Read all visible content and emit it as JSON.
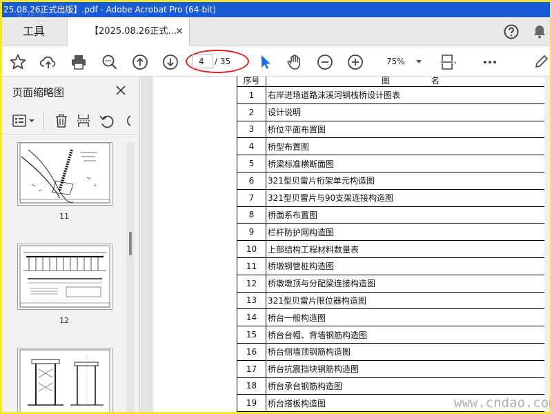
{
  "window": {
    "title": "25.08.26正式出版】.pdf - Adobe Acrobat Pro (64-bit)",
    "watermark_logo": "查标网"
  },
  "tabs": {
    "tools_label": "工具",
    "doc_label": "【2025.08.26正式...",
    "close_glyph": "✕"
  },
  "toolbar": {
    "page_current": "4",
    "page_total": "/ 35",
    "zoom": "75%"
  },
  "sidepanel": {
    "title": "页面缩略图",
    "thumbnails": [
      {
        "label": "11"
      },
      {
        "label": "12"
      },
      {
        "label": ""
      }
    ]
  },
  "document": {
    "header": {
      "no": "序号",
      "name": "图　　　　　名"
    },
    "rows": [
      {
        "no": "1",
        "name": "右岸进场道路沫溪河钢栈桥设计图表"
      },
      {
        "no": "2",
        "name": "设计说明"
      },
      {
        "no": "3",
        "name": "桥位平面布置图"
      },
      {
        "no": "4",
        "name": "桥型布置图"
      },
      {
        "no": "5",
        "name": "桥梁标准横断面图"
      },
      {
        "no": "6",
        "name": "321型贝雷片桁架单元构造图"
      },
      {
        "no": "7",
        "name": "321型贝雷片与90支架连接构造图"
      },
      {
        "no": "8",
        "name": "桥面系布置图"
      },
      {
        "no": "9",
        "name": "栏杆防护网构造图"
      },
      {
        "no": "10",
        "name": "上部结构工程材料数量表"
      },
      {
        "no": "11",
        "name": "桥墩钢管桩构造图"
      },
      {
        "no": "12",
        "name": "桥墩墩顶与分配梁连接构造图"
      },
      {
        "no": "13",
        "name": "321型贝雷片限位器构造图"
      },
      {
        "no": "14",
        "name": "桥台一般构造图"
      },
      {
        "no": "15",
        "name": "桥台台帽、背墙钢筋构造图"
      },
      {
        "no": "16",
        "name": "桥台侧墙顶钢筋构造图"
      },
      {
        "no": "17",
        "name": "桥台抗震挡块钢筋构造图"
      },
      {
        "no": "18",
        "name": "桥台承台钢筋构造图"
      },
      {
        "no": "19",
        "name": "桥台搭板构造图"
      }
    ]
  },
  "site_watermark": "www.cndao.com",
  "colors": {
    "titlebar": "#1c5bd8",
    "accent": "#1a6fe0",
    "highlight_ring": "#d92020",
    "frame": "#f0e830"
  }
}
